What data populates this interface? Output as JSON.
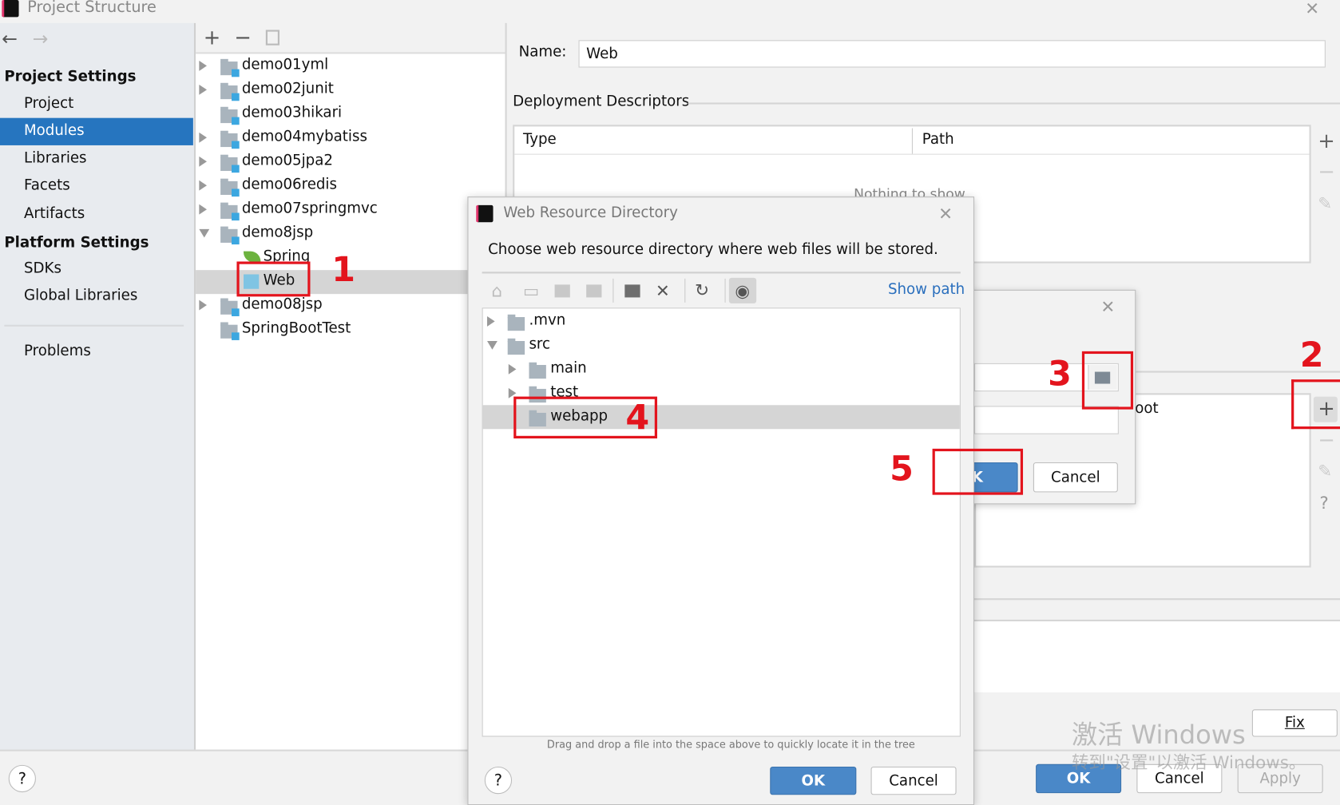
{
  "window": {
    "title": "Project Structure"
  },
  "sidebar": {
    "sections": [
      {
        "title": "Project Settings",
        "items": [
          "Project",
          "Modules",
          "Libraries",
          "Facets",
          "Artifacts"
        ]
      },
      {
        "title": "Platform Settings",
        "items": [
          "SDKs",
          "Global Libraries"
        ]
      }
    ],
    "problems": "Problems",
    "selected": "Modules"
  },
  "modules": {
    "tree": [
      "demo01yml",
      "demo02junit",
      "demo03hikari",
      "demo04mybatiss",
      "demo05jpa2",
      "demo06redis",
      "demo07springmvc",
      "demo8jsp",
      "Spring",
      "Web",
      "demo08jsp",
      "SpringBootTest"
    ],
    "selected": "Web"
  },
  "details": {
    "name_label": "Name:",
    "name_value": "Web",
    "deployment_title": "Deployment Descriptors",
    "columns": [
      "Type",
      "Path"
    ],
    "empty_text": "Nothing to show",
    "partial_text": "oot",
    "fix_label": "Fix"
  },
  "footer": {
    "ok": "OK",
    "cancel": "Cancel",
    "apply": "Apply",
    "help": "?"
  },
  "middle_dialog": {
    "ok_partial": "K",
    "cancel": "Cancel"
  },
  "dialog": {
    "title": "Web Resource Directory",
    "description": "Choose web resource directory where web files will be stored.",
    "show_path": "Show path",
    "tree": [
      ".mvn",
      "src",
      "main",
      "test",
      "webapp"
    ],
    "selected": "webapp",
    "hint": "Drag and drop a file into the space above to quickly locate it in the tree",
    "ok": "OK",
    "cancel": "Cancel",
    "help": "?"
  },
  "annotations": [
    "1",
    "2",
    "3",
    "4",
    "5"
  ],
  "watermark": {
    "line1": "激活 Windows",
    "line2": "转到\"设置\"以激活 Windows。"
  },
  "colors": {
    "selection": "#2675bf",
    "accent_button": "#4a88c8",
    "annotation": "#e3141d",
    "link": "#2a6fbd"
  }
}
